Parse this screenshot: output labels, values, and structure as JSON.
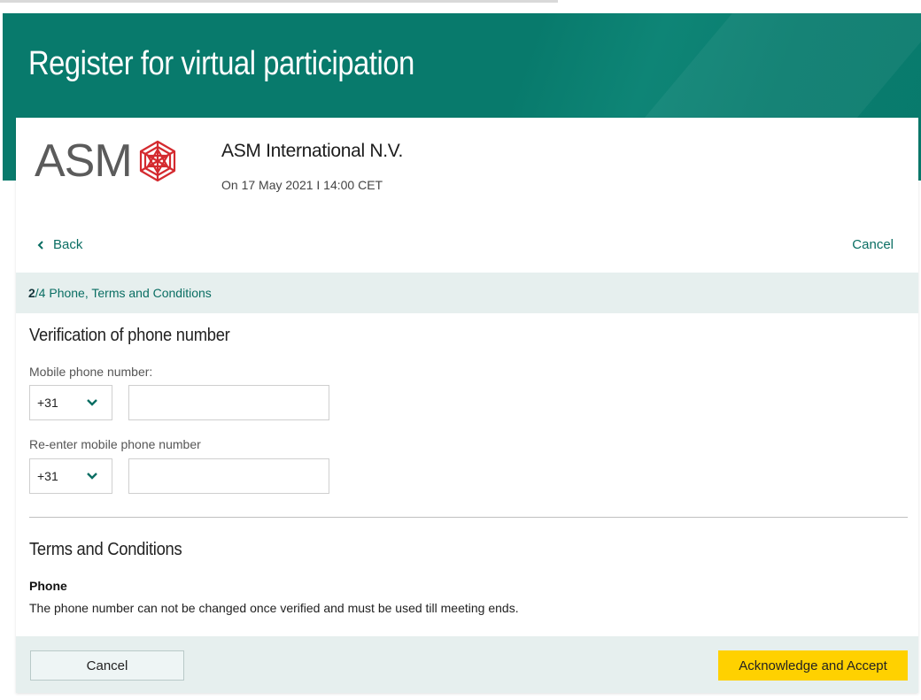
{
  "page": {
    "title": "Register for virtual participation"
  },
  "event": {
    "logo_text": "ASM",
    "company": "ASM International N.V.",
    "date": "On 17 May 2021 I 14:00 CET"
  },
  "nav": {
    "back_label": "Back",
    "cancel_label": "Cancel"
  },
  "step": {
    "current": "2",
    "rest": "/4 Phone, Terms and Conditions"
  },
  "verification": {
    "title": "Verification of phone number",
    "mobile_label": "Mobile phone number:",
    "mobile_code": "+31",
    "mobile_value": "",
    "reenter_label": "Re-enter mobile phone number",
    "reenter_code": "+31",
    "reenter_value": ""
  },
  "terms": {
    "title": "Terms and Conditions",
    "subtitle": "Phone",
    "text": "The phone number can not be changed once verified and must be used till meeting ends."
  },
  "footer": {
    "cancel_label": "Cancel",
    "accept_label": "Acknowledge and Accept"
  },
  "colors": {
    "brand_teal": "#087a6c",
    "accent_yellow": "#ffd100",
    "logo_red": "#d42a2f"
  },
  "icons": [
    "chevron-left-icon",
    "chevron-down-icon",
    "asm-logo-mark-icon"
  ]
}
